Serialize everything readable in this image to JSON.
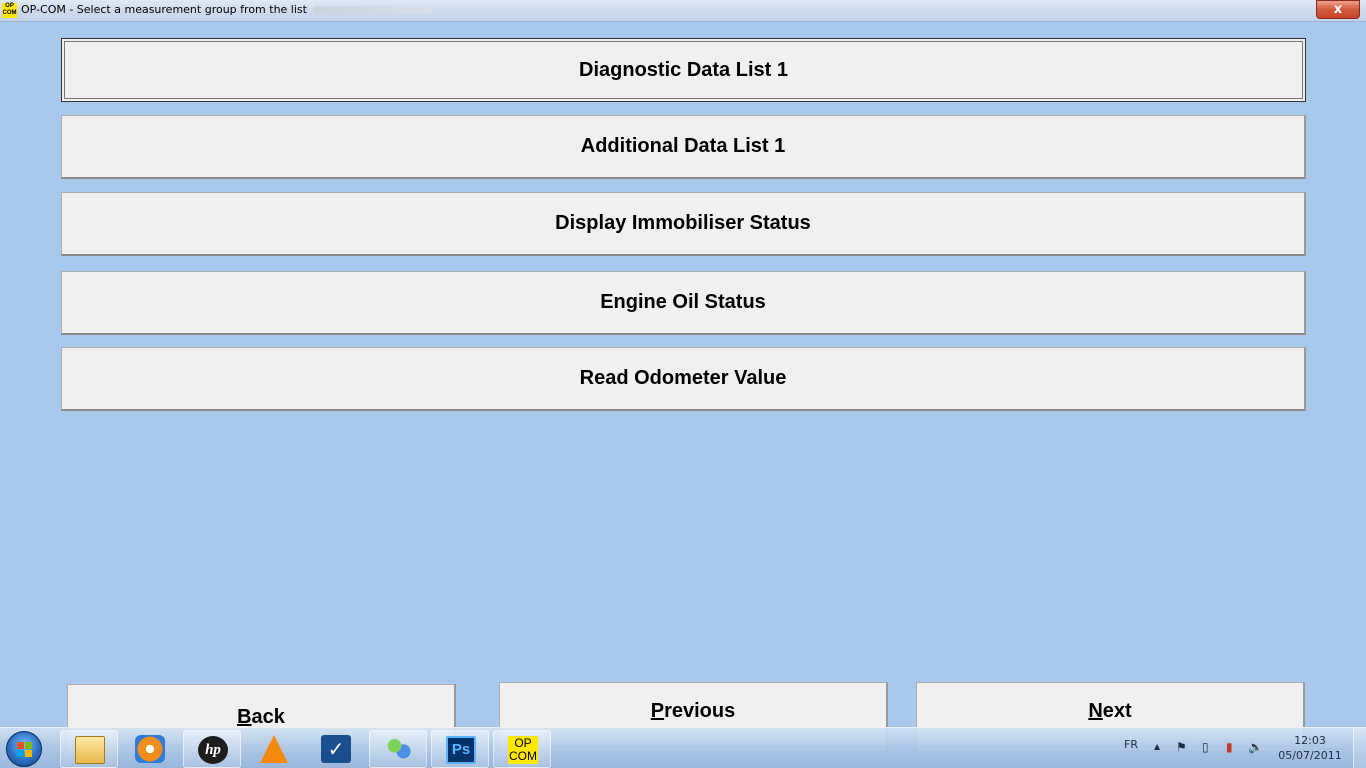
{
  "window": {
    "app_icon": {
      "line1": "OP",
      "line2": "COM"
    },
    "title": "OP-COM -  Select a measurement group from the list",
    "close_label": "x"
  },
  "groups": [
    {
      "label": "Diagnostic Data List 1"
    },
    {
      "label": "Additional Data List 1"
    },
    {
      "label": "Display Immobiliser Status"
    },
    {
      "label": "Engine Oil Status"
    },
    {
      "label": "Read Odometer Value"
    }
  ],
  "nav": {
    "back": {
      "accel": "B",
      "rest": "ack"
    },
    "previous": {
      "accel": "P",
      "rest": "revious"
    },
    "next": {
      "accel": "N",
      "rest": "ext"
    }
  },
  "taskbar": {
    "apps": [
      {
        "name": "windows-explorer"
      },
      {
        "name": "windows-media-player"
      },
      {
        "name": "hp",
        "text": "hp"
      },
      {
        "name": "vlc"
      },
      {
        "name": "check-app",
        "text": "✓"
      },
      {
        "name": "messenger"
      },
      {
        "name": "photoshop",
        "text": "Ps"
      },
      {
        "name": "op-com",
        "line1": "OP",
        "line2": "COM"
      }
    ],
    "language": "FR",
    "tray": {
      "show_hidden": "▲",
      "flag": "⚑",
      "battery": "▯",
      "network": "▮",
      "volume": "🔈"
    },
    "time": "12:03",
    "date": "05/07/2011"
  }
}
